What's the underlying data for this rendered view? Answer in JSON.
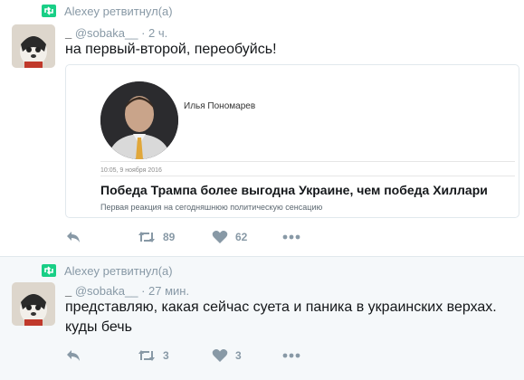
{
  "tweets": [
    {
      "retweeter_line": "Alexey ретвитнул(а)",
      "display_name": "_",
      "handle": "@sobaka__",
      "time": "· 2 ч.",
      "text": "на первый-второй, переобуйсь!",
      "card": {
        "author": "Илья Пономарев",
        "date": "10:05, 9 ноября 2016",
        "title": "Победа Трампа более выгодна Украине, чем победа Хиллари",
        "subtitle": "Первая реакция на сегодняшнюю политическую сенсацию"
      },
      "retweet_count": "89",
      "like_count": "62"
    },
    {
      "retweeter_line": "Alexey ретвитнул(а)",
      "display_name": "_",
      "handle": "@sobaka__",
      "time": "· 27 мин.",
      "text_line1": "представляю, какая сейчас суета и паника в украинских верхах.",
      "text_line2": "куды бечь",
      "retweet_count": "3",
      "like_count": "3"
    }
  ],
  "colors": {
    "retweet_badge": "#19cf86",
    "muted": "#8899a6",
    "text": "#14171a",
    "alt_background": "#f5f8fa"
  },
  "icons": [
    "retweet-badge-icon",
    "reply-icon",
    "retweet-icon",
    "heart-icon",
    "more-icon"
  ]
}
